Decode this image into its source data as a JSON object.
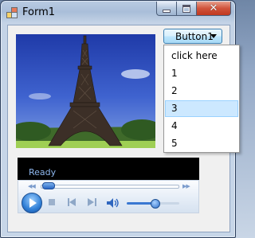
{
  "window": {
    "title": "Form1"
  },
  "dropdown_button": {
    "label": "Button1"
  },
  "menu": {
    "items": [
      "click here",
      "1",
      "2",
      "3",
      "4",
      "5"
    ],
    "selected_index": 3
  },
  "media_player": {
    "status": "Ready",
    "seek_position": 0.0,
    "volume_level": 0.5
  },
  "colors": {
    "menu_highlight": "#cce8ff",
    "button_border": "#3c7fb1",
    "status_text": "#8fb8ef",
    "close_button": "#c0381f"
  },
  "icons": [
    "app-icon",
    "minimize-icon",
    "maximize-icon",
    "close-icon",
    "chevron-down-icon",
    "play-icon",
    "stop-icon",
    "previous-icon",
    "next-icon",
    "volume-icon",
    "rewind-icon",
    "fast-forward-icon"
  ]
}
